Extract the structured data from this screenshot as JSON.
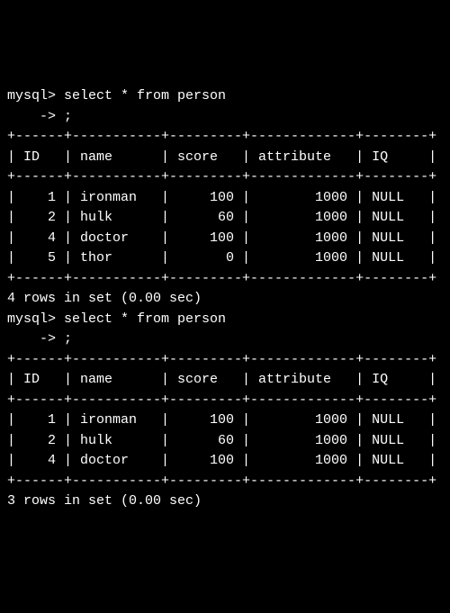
{
  "queries": [
    {
      "prompt1": "mysql> ",
      "stmt": "select * from person",
      "prompt2": "    -> ",
      "terminator": ";",
      "columns": [
        "ID",
        "name",
        "score",
        "attribute",
        "IQ"
      ],
      "rows": [
        {
          "ID": 1,
          "name": "ironman",
          "score": 100,
          "attribute": 1000,
          "IQ": "NULL"
        },
        {
          "ID": 2,
          "name": "hulk",
          "score": 60,
          "attribute": 1000,
          "IQ": "NULL"
        },
        {
          "ID": 4,
          "name": "doctor",
          "score": 100,
          "attribute": 1000,
          "IQ": "NULL"
        },
        {
          "ID": 5,
          "name": "thor",
          "score": 0,
          "attribute": 1000,
          "IQ": "NULL"
        }
      ],
      "footer": "4 rows in set (0.00 sec)"
    },
    {
      "prompt1": "mysql> ",
      "stmt": "select * from person",
      "prompt2": "    -> ",
      "terminator": ";",
      "columns": [
        "ID",
        "name",
        "score",
        "attribute",
        "IQ"
      ],
      "rows": [
        {
          "ID": 1,
          "name": "ironman",
          "score": 100,
          "attribute": 1000,
          "IQ": "NULL"
        },
        {
          "ID": 2,
          "name": "hulk",
          "score": 60,
          "attribute": 1000,
          "IQ": "NULL"
        },
        {
          "ID": 4,
          "name": "doctor",
          "score": 100,
          "attribute": 1000,
          "IQ": "NULL"
        }
      ],
      "footer": "3 rows in set (0.00 sec)"
    }
  ],
  "widths": {
    "ID": 4,
    "name": 9,
    "score": 7,
    "attribute": 11,
    "IQ": 6
  }
}
